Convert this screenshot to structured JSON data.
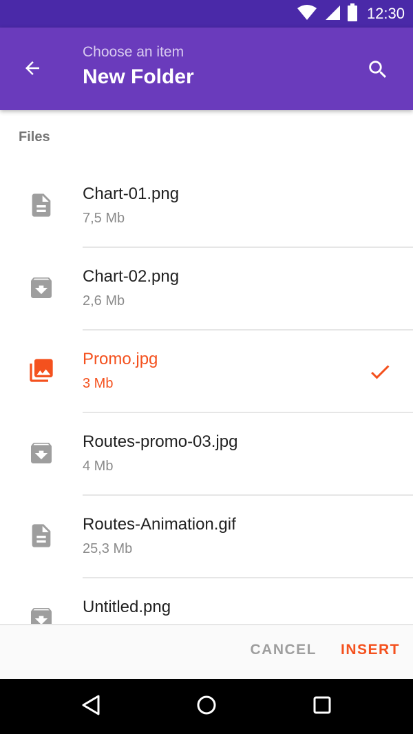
{
  "status_bar": {
    "time": "12:30"
  },
  "app_bar": {
    "subtitle": "Choose an item",
    "title": "New Folder"
  },
  "section": {
    "header": "Files"
  },
  "files": [
    {
      "name": "Chart-01.png",
      "size": "7,5 Mb",
      "icon": "document-icon",
      "selected": false
    },
    {
      "name": "Chart-02.png",
      "size": "2,6 Mb",
      "icon": "archive-icon",
      "selected": false
    },
    {
      "name": "Promo.jpg",
      "size": "3 Mb",
      "icon": "image-icon",
      "selected": true
    },
    {
      "name": "Routes-promo-03.jpg",
      "size": "4 Mb",
      "icon": "archive-icon",
      "selected": false
    },
    {
      "name": "Routes-Animation.gif",
      "size": "25,3 Mb",
      "icon": "document-icon",
      "selected": false
    },
    {
      "name": "Untitled.png",
      "size": "",
      "icon": "archive-icon",
      "selected": false
    }
  ],
  "actions": {
    "cancel": "CANCEL",
    "insert": "INSERT"
  },
  "colors": {
    "status_bar": "#4a29a8",
    "app_bar": "#6a3bbc",
    "accent": "#f4511e",
    "icon_grey": "#9e9e9e"
  }
}
